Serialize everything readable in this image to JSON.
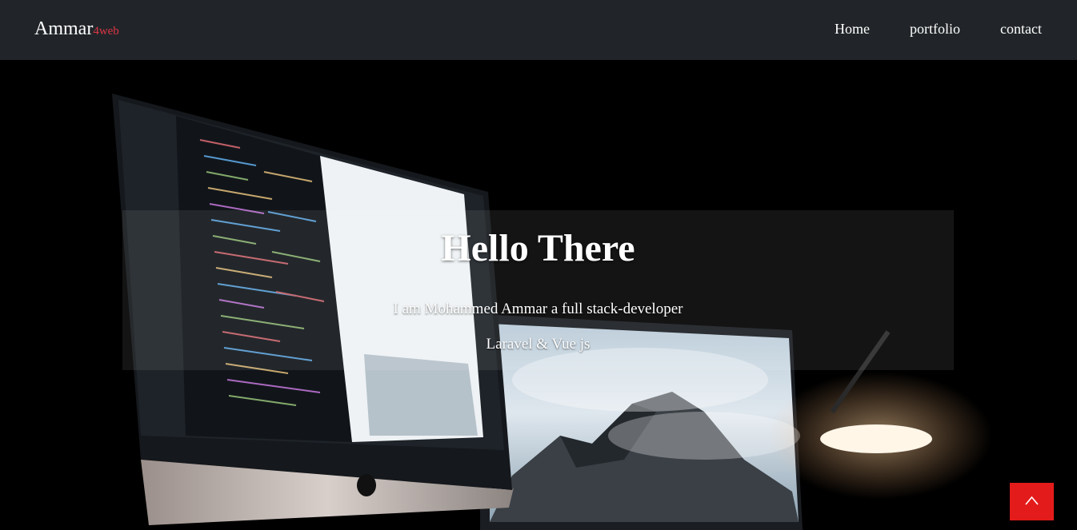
{
  "navbar": {
    "brand": {
      "name": "Ammar",
      "suffix": "4web"
    },
    "links": [
      {
        "label": "Home"
      },
      {
        "label": "portfolio"
      },
      {
        "label": "contact"
      }
    ]
  },
  "hero": {
    "title": "Hello There",
    "subtitle": "I am Mohammed Ammar a full stack-developer",
    "stack": "Laravel & Vue js",
    "background_image_description": "workspace with desktop monitor showing code and a second monitor with mountain photo"
  },
  "scroll_top": {
    "icon": "chevron-up-icon"
  },
  "colors": {
    "navbar_bg": "#212529",
    "accent_red": "#e41b1b",
    "brand_suffix": "#dc3545"
  }
}
